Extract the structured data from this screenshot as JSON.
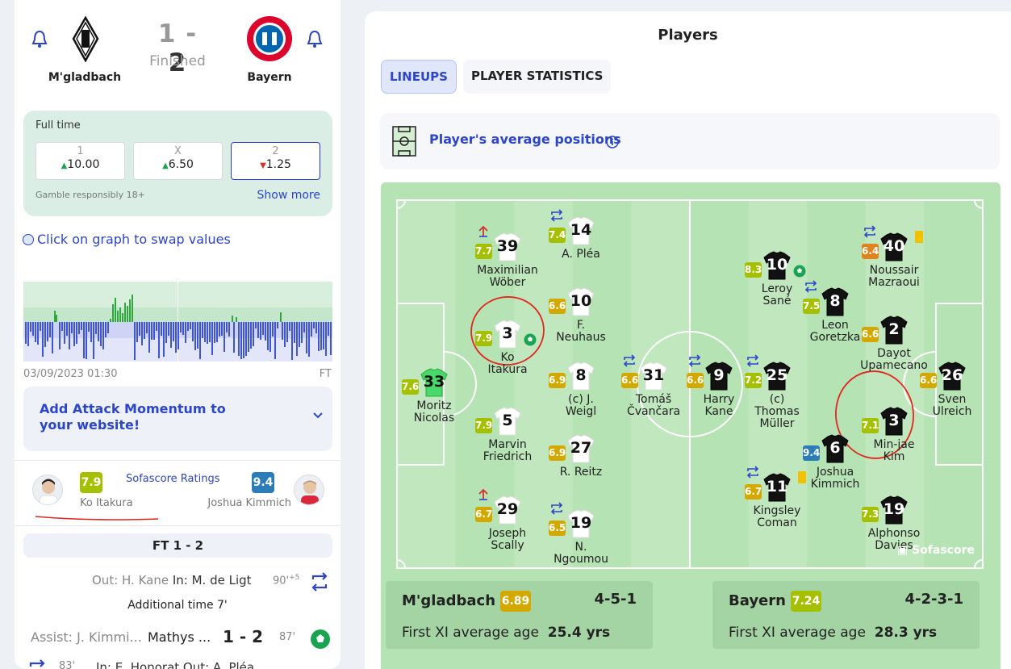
{
  "match": {
    "home_team": "M'gladbach",
    "away_team": "Bayern",
    "home_score": "1",
    "dash": "-",
    "away_score": "2",
    "status": "Finished"
  },
  "odds": {
    "label": "Full time",
    "options": [
      {
        "key": "1",
        "value": "10.00",
        "trend": "up"
      },
      {
        "key": "X",
        "value": "6.50",
        "trend": "up"
      },
      {
        "key": "2",
        "value": "1.25",
        "trend": "down"
      }
    ],
    "gamble": "Gamble responsibly 18+",
    "show_more": "Show more"
  },
  "swap_label": "Click on graph to swap values",
  "momentum": {
    "date": "03/09/2023 01:30",
    "end": "FT"
  },
  "promo": {
    "text": "Add Attack Momentum to your website!"
  },
  "ratings": {
    "title": "Sofascore Ratings",
    "home_player": "Ko Itakura",
    "home_rating": "7.9",
    "away_player": "Joshua Kimmich",
    "away_rating": "9.4"
  },
  "timeline": {
    "ft_label": "FT 1 - 2",
    "events": [
      {
        "text_out": "Out: H. Kane",
        "text_in": "In: M. de Ligt",
        "minute": "90'",
        "added": "+5"
      },
      {
        "added_time": "Additional time 7'"
      },
      {
        "assist": "Assist: J. Kimmi...",
        "scorer": "Mathys ...",
        "score": "1 - 2",
        "minute": "87'"
      },
      {
        "partial": "In: E. Honorat  Out: A. Pléa",
        "minute": "83'"
      }
    ]
  },
  "players_panel": {
    "title": "Players",
    "tabs": [
      "LINEUPS",
      "PLAYER STATISTICS"
    ],
    "avg_label": "Player's average positions",
    "home": {
      "name": "M'gladbach",
      "avg": "6.89",
      "formation": "4-5-1",
      "age_label": "First XI average age",
      "age": "25.4 yrs"
    },
    "away": {
      "name": "Bayern",
      "avg": "7.24",
      "formation": "4-2-3-1",
      "age_label": "First XI average age",
      "age": "28.3 yrs"
    },
    "brand": "Sofascore"
  },
  "home_players": [
    {
      "num": "33",
      "name": "Moritz\nNicolas",
      "rating": "7.6",
      "gk": true
    },
    {
      "num": "39",
      "name": "Maximilian\nWöber",
      "rating": "7.7",
      "sub": "out"
    },
    {
      "num": "14",
      "name": "A. Pléa",
      "rating": "7.4",
      "sub": "swap"
    },
    {
      "num": "10",
      "name": "F.\nNeuhaus",
      "rating": "6.6"
    },
    {
      "num": "3",
      "name": "Ko\nItakura",
      "rating": "7.9",
      "goal": true
    },
    {
      "num": "8",
      "name": "(c) J.\nWeigl",
      "rating": "6.9"
    },
    {
      "num": "31",
      "name": "Tomáš\nČvančara",
      "rating": "6.6",
      "sub": "swap"
    },
    {
      "num": "5",
      "name": "Marvin\nFriedrich",
      "rating": "7.9"
    },
    {
      "num": "27",
      "name": "R. Reitz",
      "rating": "6.9"
    },
    {
      "num": "29",
      "name": "Joseph\nScally",
      "rating": "6.7",
      "sub": "out"
    },
    {
      "num": "19",
      "name": "N.\nNgoumou",
      "rating": "6.5",
      "sub": "swap"
    }
  ],
  "away_players": [
    {
      "num": "40",
      "name": "Noussair\nMazraoui",
      "rating": "6.4",
      "sub": "swap",
      "card": true
    },
    {
      "num": "10",
      "name": "Leroy\nSané",
      "rating": "8.3",
      "goal": true
    },
    {
      "num": "8",
      "name": "Leon\nGoretzka",
      "rating": "7.5",
      "sub": "swap"
    },
    {
      "num": "2",
      "name": "Dayot\nUpamecano",
      "rating": "6.6"
    },
    {
      "num": "9",
      "name": "Harry\nKane",
      "rating": "6.6",
      "sub": "swap"
    },
    {
      "num": "25",
      "name": "(c)\nThomas\nMüller",
      "rating": "7.2",
      "sub": "swap"
    },
    {
      "num": "26",
      "name": "Sven\nUlreich",
      "rating": "6.6",
      "gk": true
    },
    {
      "num": "3",
      "name": "Min-jae\nKim",
      "rating": "7.1"
    },
    {
      "num": "6",
      "name": "Joshua\nKimmich",
      "rating": "9.4"
    },
    {
      "num": "11",
      "name": "Kingsley\nComan",
      "rating": "6.7",
      "sub": "swap",
      "card": true
    },
    {
      "num": "19",
      "name": "Alphonso\nDavies",
      "rating": "7.3"
    }
  ],
  "colors": {
    "accent": "#2c45c9",
    "pitch": "#b6e3b4",
    "rating_green": "#a4c000",
    "rating_gold": "#d5a800",
    "rating_orange": "#e3811b",
    "rating_blue": "#2a7db8"
  }
}
